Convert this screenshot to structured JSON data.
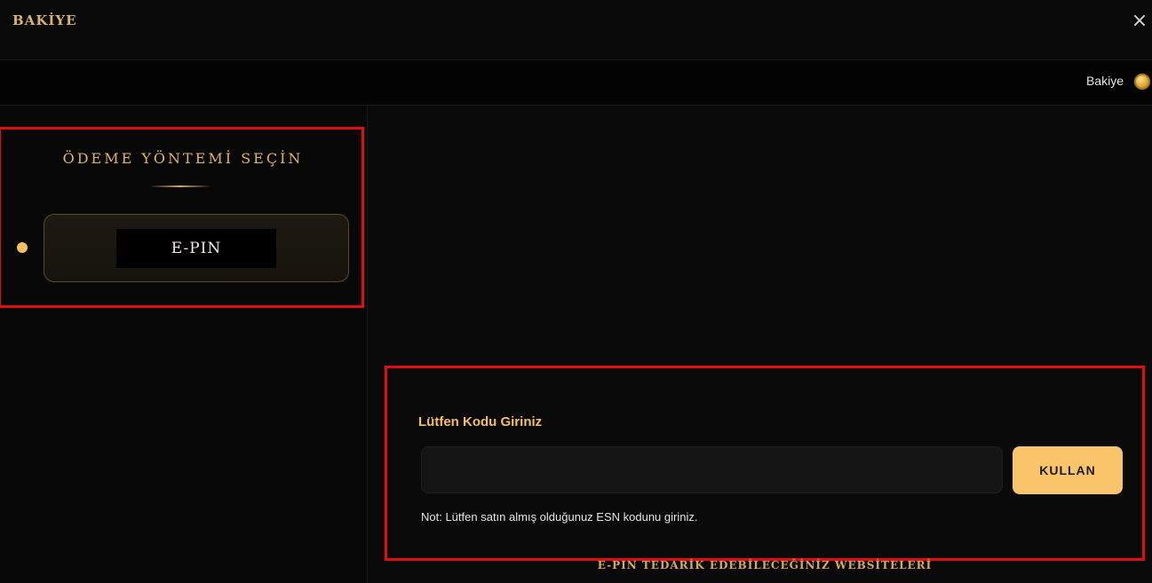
{
  "window": {
    "title": "BAKİYE",
    "close_label": "×"
  },
  "balance_bar": {
    "label": "Bakiye",
    "icon": "coin-icon"
  },
  "payment_methods": {
    "heading": "ÖDEME YÖNTEMİ SEÇİN",
    "items": [
      {
        "label": "E-PIN",
        "selected": true
      }
    ]
  },
  "code_entry": {
    "label": "Lütfen Kodu Giriniz",
    "input_value": "",
    "input_placeholder": "",
    "submit_label": "KULLAN",
    "note": "Not: Lütfen satın almış olduğunuz ESN kodunu giriniz."
  },
  "sites": {
    "heading": "E-PIN TEDARİK EDEBİLECEĞİNİZ WEBSİTELERİ"
  },
  "colors": {
    "accent_gold": "#f9c46a",
    "heading_gold": "#e0b463",
    "highlight_red": "#e20d0d",
    "background": "#0a0a0a"
  }
}
